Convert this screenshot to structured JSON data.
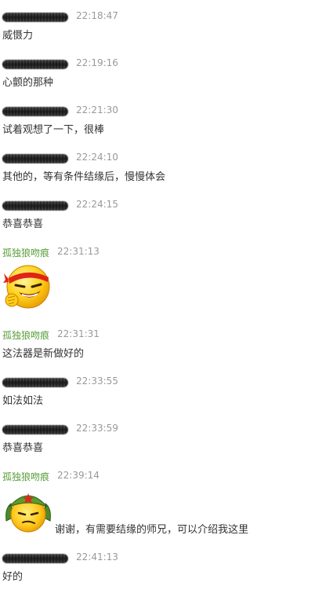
{
  "messages": [
    {
      "sender": "",
      "time": "22:18:47",
      "text": "威慑力"
    },
    {
      "sender": "",
      "time": "22:19:16",
      "text": "心颤的那种"
    },
    {
      "sender": "",
      "time": "22:21:30",
      "text": "试着观想了一下，很棒"
    },
    {
      "sender": "",
      "time": "22:24:10",
      "text": "其他的，等有条件结缘后，慢慢体会"
    },
    {
      "sender": "",
      "time": "22:24:15",
      "text": "恭喜恭喜"
    },
    {
      "sender": "孤独狼吻痕",
      "time": "22:31:13",
      "emoji": "grinning-headband-emoji"
    },
    {
      "sender": "孤独狼吻痕",
      "time": "22:31:31",
      "text": "这法器是新做好的"
    },
    {
      "sender": "",
      "time": "22:33:55",
      "text": "如法如法"
    },
    {
      "sender": "",
      "time": "22:33:59",
      "text": "恭喜恭喜"
    },
    {
      "sender": "孤独狼吻痕",
      "time": "22:39:14",
      "emoji": "soldier-cap-emoji",
      "text": "谢谢，有需要结缘的师兄，可以介绍我这里"
    },
    {
      "sender": "",
      "time": "22:41:13",
      "text": "好的"
    }
  ],
  "colors": {
    "sender_highlight": "#5a9e3a",
    "timestamp": "#999999",
    "message_text": "#333333",
    "background": "#ffffff"
  }
}
